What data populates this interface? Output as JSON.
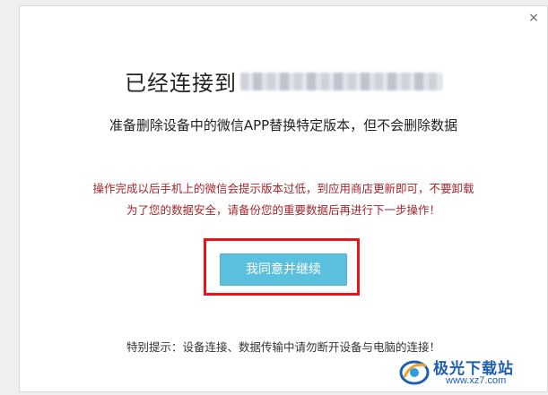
{
  "dialog": {
    "close_glyph": "×",
    "title": "已经连接到",
    "device_name_blurred": true,
    "subtitle": "准备删除设备中的微信APP替换特定版本，但不会删除数据",
    "warning_lines": [
      "操作完成以后手机上的微信会提示版本过低，到应用商店更新即可，不要卸载",
      "为了您的数据安全，请备份您的重要数据后再进行下一步操作！"
    ],
    "agree_button_label": "我同意并继续",
    "bottom_tip": "特别提示：设备连接、数据传输中请勿断开设备与电脑的连接！"
  },
  "watermark": {
    "brand": "极光下载站",
    "url": "www.xz7.com"
  },
  "colors": {
    "warning_text": "#a4262c",
    "button_bg": "#5bc0de",
    "highlight_border": "#e8141c",
    "watermark": "#1e5fb3"
  }
}
